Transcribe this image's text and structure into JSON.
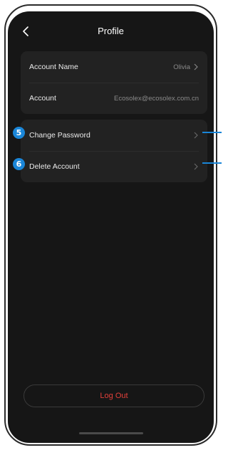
{
  "header": {
    "title": "Profile",
    "back_icon": "chevron-left-icon"
  },
  "account_group": {
    "rows": [
      {
        "label": "Account Name",
        "value": "Olivia",
        "has_chevron": true
      },
      {
        "label": "Account",
        "value": "Ecosolex@ecosolex.com.cn",
        "has_chevron": false
      }
    ]
  },
  "security_group": {
    "rows": [
      {
        "label": "Change Password",
        "badge": "5"
      },
      {
        "label": "Delete Account",
        "badge": "6"
      }
    ]
  },
  "logout": {
    "label": "Log Out",
    "color": "#e2403a"
  },
  "colors": {
    "background": "#161616",
    "card": "#222222",
    "accent_badge": "#1a86d8"
  }
}
